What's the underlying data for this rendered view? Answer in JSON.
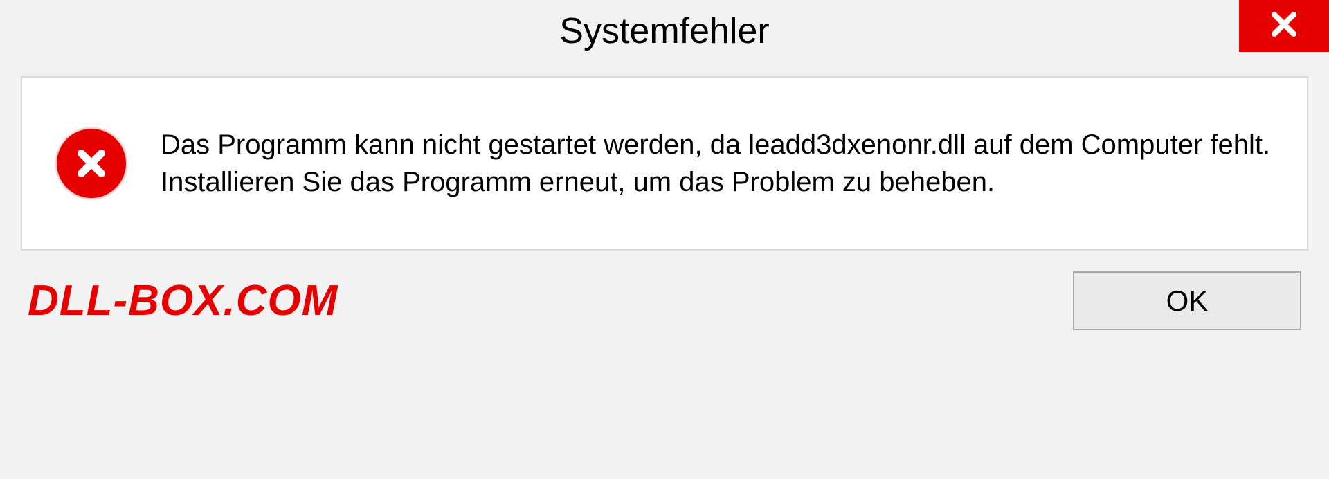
{
  "titlebar": {
    "title": "Systemfehler"
  },
  "dialog": {
    "message": "Das Programm kann nicht gestartet werden, da leadd3dxenonr.dll auf dem Computer fehlt. Installieren Sie das Programm erneut, um das Problem zu beheben."
  },
  "footer": {
    "watermark": "DLL-BOX.COM",
    "ok_label": "OK"
  },
  "colors": {
    "error_red": "#e60000",
    "bg_gray": "#f2f2f2"
  }
}
